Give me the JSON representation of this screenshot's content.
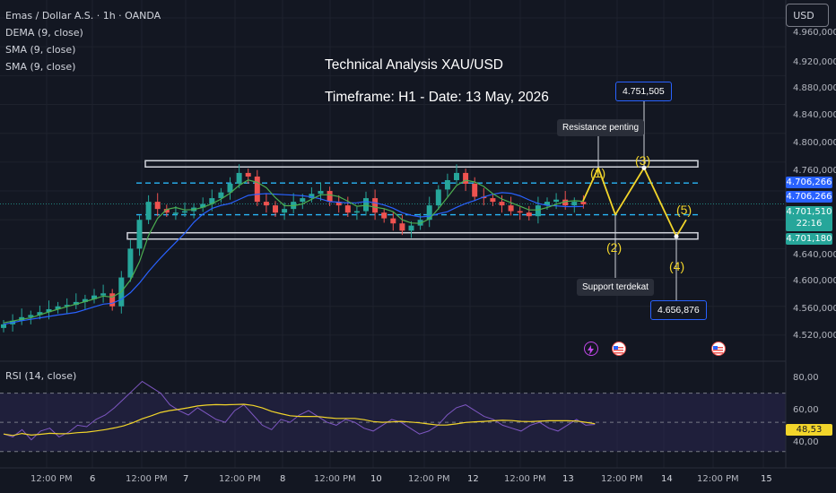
{
  "header": {
    "symbol": "Emas / Dollar A.S. · 1h · OANDA",
    "indicators": [
      "DEMA (9, close)",
      "SMA (9, close)",
      "SMA (9, close)"
    ],
    "currency": "USD"
  },
  "annotations": {
    "title": "Technical Analysis XAU/USD",
    "subtitle": "Timeframe: H1 - Date: 13 May, 2026",
    "resistance": "Resistance penting",
    "support": "Support terdekat",
    "target_high": "4.751,505",
    "target_low": "4.656,876",
    "waves": [
      "(1)",
      "(2)",
      "(3)",
      "(4)",
      "(5)"
    ]
  },
  "price_axis": {
    "labels": [
      "4.960,000",
      "4.920,000",
      "4.880,000",
      "4.840,000",
      "4.800,000",
      "4.760,000",
      "4.640,000",
      "4.600,000",
      "4.560,000",
      "4.520,000"
    ],
    "tags": {
      "dema": "4.706,266",
      "sma": "4.706,266",
      "last": "4.701,510",
      "countdown": "22:16",
      "sma2": "4.701,180"
    }
  },
  "time_axis": [
    "12:00 PM",
    "6",
    "12:00 PM",
    "7",
    "12:00 PM",
    "8",
    "12:00 PM",
    "10",
    "12:00 PM",
    "12",
    "12:00 PM",
    "13",
    "12:00 PM",
    "14",
    "12:00 PM",
    "15"
  ],
  "rsi": {
    "label": "RSI (14, close)",
    "axis": [
      "80,00",
      "60,00",
      "40,00"
    ],
    "value": "48,53"
  },
  "colors": {
    "bg": "#131722",
    "up": "#26a69a",
    "down": "#ef5350",
    "accent": "#2962ff",
    "wave": "#f2d52a",
    "rsi": "#7e57c2",
    "rsi_ma": "#f2d52a"
  },
  "chart_data": {
    "type": "candlestick",
    "series": [
      {
        "name": "Emas / Dollar A.S. · 1h · OANDA",
        "close": [
          4535,
          4540,
          4545,
          4548,
          4552,
          4556,
          4560,
          4562,
          4566,
          4570,
          4575,
          4578,
          4560,
          4600,
          4640,
          4680,
          4705,
          4695,
          4690,
          4690,
          4692,
          4697,
          4702,
          4710,
          4718,
          4730,
          4745,
          4740,
          4705,
          4700,
          4690,
          4695,
          4705,
          4710,
          4716,
          4720,
          4705,
          4700,
          4690,
          4692,
          4710,
          4690,
          4682,
          4675,
          4665,
          4672,
          4680,
          4700,
          4722,
          4735,
          4745,
          4730,
          4712,
          4710,
          4705,
          4700,
          4692,
          4690,
          4685,
          4700,
          4705,
          4708,
          4700,
          4705,
          4701.51
        ]
      }
    ],
    "ylim": [
      4500,
      4960
    ],
    "resistance_zone": [
      4751.505,
      4760
    ],
    "support_zone": [
      4656.876,
      4662
    ]
  }
}
